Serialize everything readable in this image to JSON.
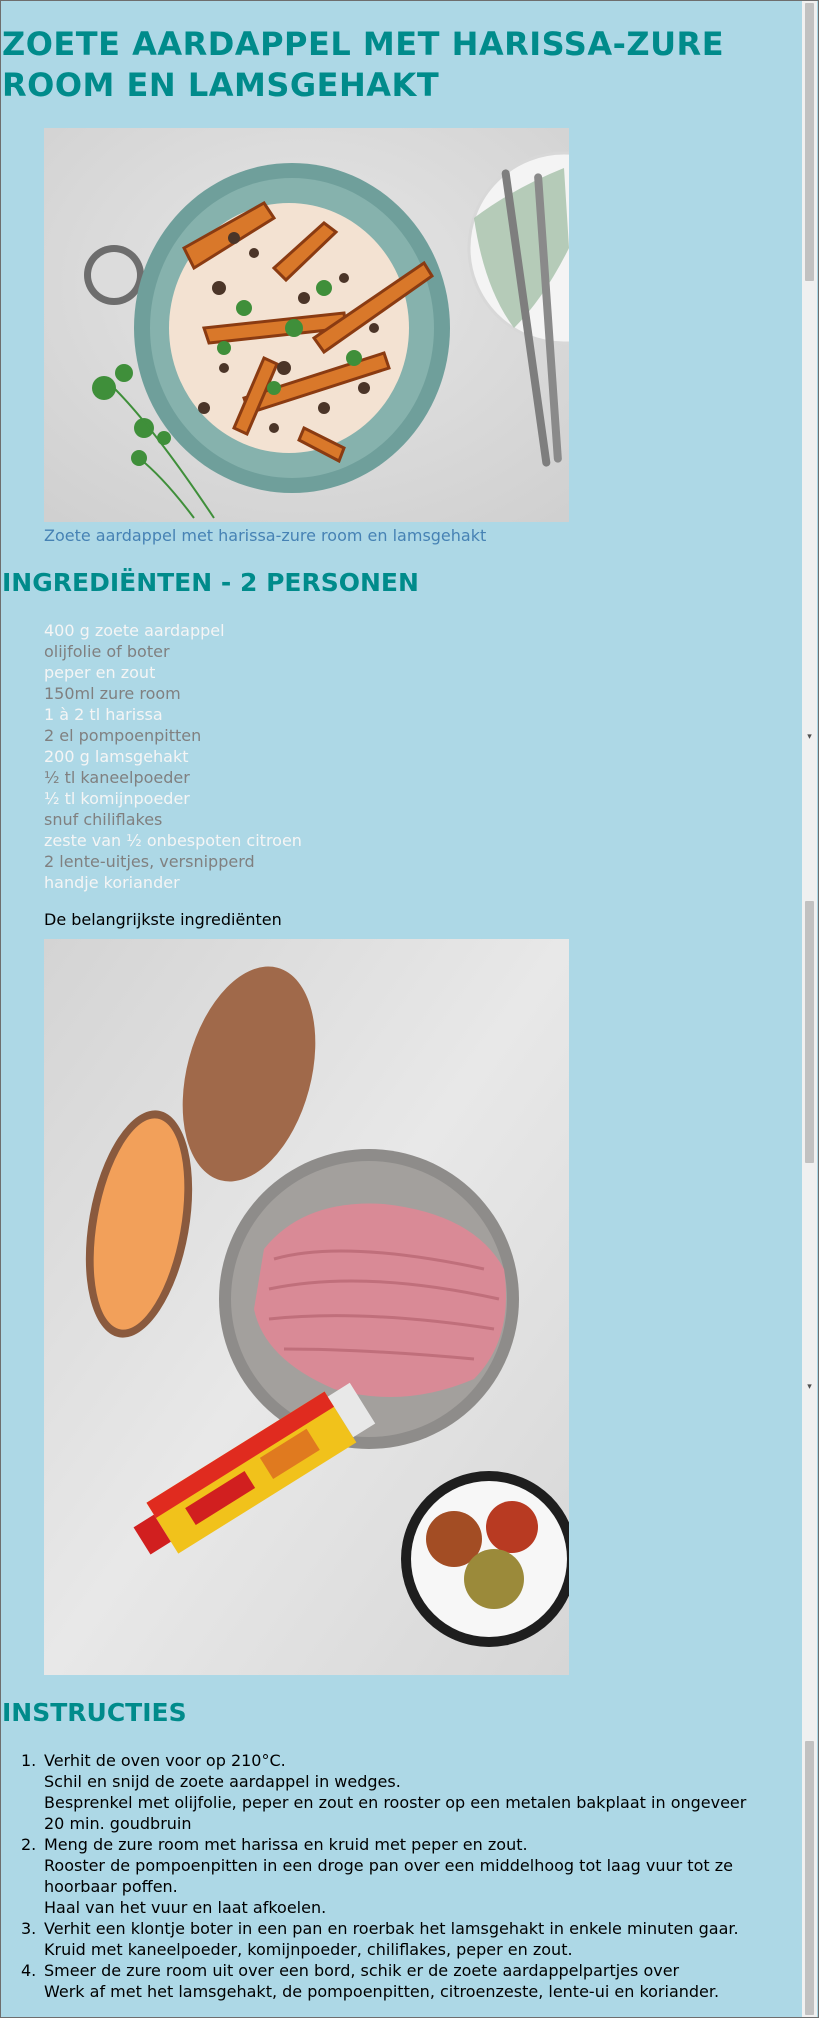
{
  "recipe": {
    "title": "ZOETE AARDAPPEL MET HARISSA-ZURE ROOM EN LAMSGEHAKT",
    "hero_caption": "Zoete aardappel met harissa-zure room en lamsgehakt",
    "ingredients_heading": "INGREDIËNTEN - 2 PERSONEN",
    "ingredients": [
      {
        "text": "400 g zoete aardappel",
        "tone": "light"
      },
      {
        "text": "olijfolie of boter",
        "tone": "gray"
      },
      {
        "text": "peper en zout",
        "tone": "light"
      },
      {
        "text": "150ml zure room",
        "tone": "gray"
      },
      {
        "text": "1 à 2 tl harissa",
        "tone": "light"
      },
      {
        "text": "2 el pompoenpitten",
        "tone": "gray"
      },
      {
        "text": "200 g lamsgehakt",
        "tone": "light"
      },
      {
        "text": "½ tl kaneelpoeder",
        "tone": "gray"
      },
      {
        "text": "½ tl komijnpoeder",
        "tone": "light"
      },
      {
        "text": "snuf chiliflakes",
        "tone": "gray"
      },
      {
        "text": "zeste van ½ onbespoten citroen",
        "tone": "light"
      },
      {
        "text": "2 lente-uitjes, versnipperd",
        "tone": "gray"
      },
      {
        "text": "handje koriander",
        "tone": "light"
      }
    ],
    "main_ingredients_label": "De belangrijkste ingrediënten",
    "instructions_heading": "INSTRUCTIES",
    "steps": [
      {
        "num": "1.",
        "lines": [
          "Verhit de oven voor op 210°C.",
          "Schil en snijd de zoete aardappel in wedges.",
          "Besprenkel met olijfolie, peper en zout en rooster op een metalen bakplaat in ongeveer",
          "20 min. goudbruin"
        ]
      },
      {
        "num": "2.",
        "lines": [
          "Meng de zure room met harissa en kruid met peper en zout.",
          "Rooster de pompoenpitten in een droge pan over een middelhoog tot laag vuur tot ze",
          "hoorbaar poffen.",
          "Haal van het vuur en laat afkoelen."
        ]
      },
      {
        "num": "3.",
        "lines": [
          "Verhit een klontje boter in een pan en roerbak het lamsgehakt in enkele minuten gaar.",
          "Kruid met kaneelpoeder, komijnpoeder, chiliflakes, peper en zout."
        ]
      },
      {
        "num": "4.",
        "lines": [
          "Smeer de zure room uit over een bord, schik er de zoete aardappelpartjes over",
          "Werk af met het lamsgehakt, de pompoenpitten, citroenzeste, lente-ui en koriander."
        ]
      }
    ]
  },
  "colors": {
    "background": "#add8e6",
    "heading": "#008b8b",
    "caption": "#4682b4"
  },
  "icons": [
    "scroll-down-arrow-icon"
  ]
}
